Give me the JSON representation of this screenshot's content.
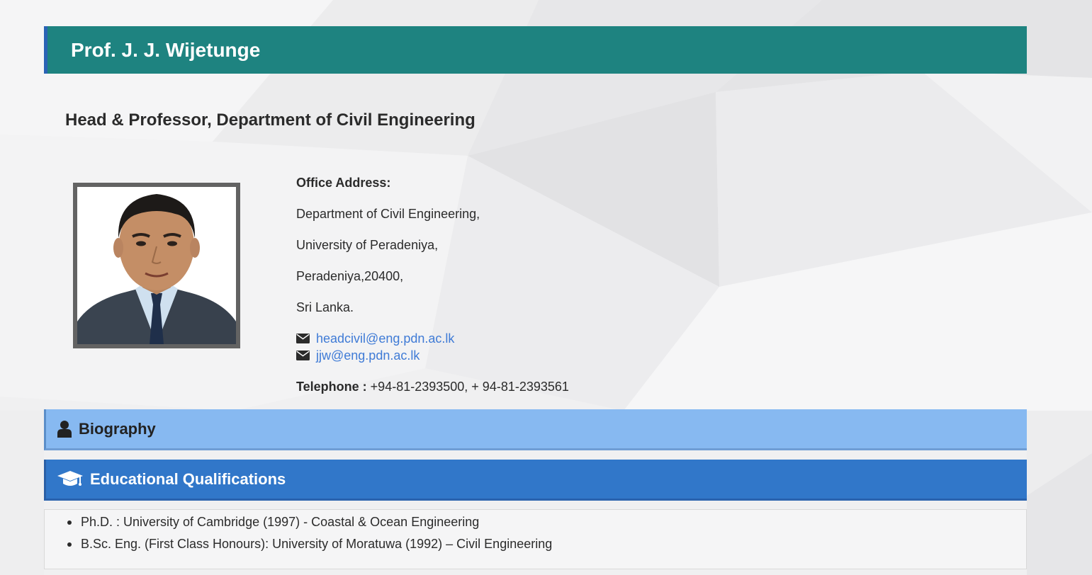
{
  "header": {
    "name": "Prof. J. J. Wijetunge",
    "position": "Head & Professor, Department of Civil Engineering"
  },
  "contact": {
    "office_label": "Office Address:",
    "address_lines": [
      "Department of Civil Engineering,",
      "University of Peradeniya,",
      "Peradeniya,20400,",
      "Sri Lanka."
    ],
    "emails": [
      "headcivil@eng.pdn.ac.lk",
      "jjw@eng.pdn.ac.lk"
    ],
    "telephone_label": "Telephone :",
    "telephone_value": " +94-81-2393500, + 94-81-2393561"
  },
  "panels": {
    "biography": {
      "title": "Biography",
      "icon": "user-icon"
    },
    "education": {
      "title": "Educational Qualifications",
      "icon": "graduation-cap-icon",
      "items": [
        "Ph.D. : University of Cambridge (1997) - Coastal & Ocean Engineering",
        "B.Sc. Eng. (First Class Honours): University of Moratuwa (1992) – Civil Engineering"
      ]
    }
  },
  "colors": {
    "title_bar": "#1e8380",
    "biography_bar": "#87b9f1",
    "education_bar": "#3177c9",
    "link": "#3f7bd6"
  }
}
